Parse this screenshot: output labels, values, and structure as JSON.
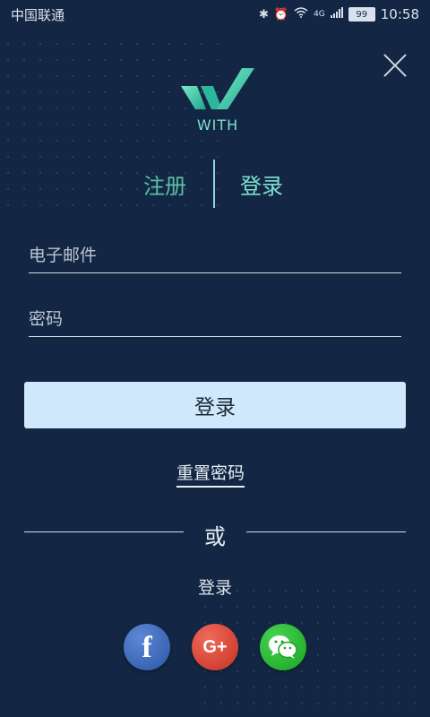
{
  "statusbar": {
    "carrier": "中国联通",
    "network": "4G",
    "battery": "99",
    "time": "10:58"
  },
  "brand": {
    "logo_text": "WITH"
  },
  "tabs": {
    "register": "注册",
    "login": "登录",
    "active": "login"
  },
  "form": {
    "email_placeholder": "电子邮件",
    "password_placeholder": "密码",
    "login_button": "登录"
  },
  "links": {
    "reset_password": "重置密码"
  },
  "divider": {
    "or": "或"
  },
  "social": {
    "label": "登录",
    "providers": [
      {
        "name": "facebook-icon",
        "color": "#3b5998"
      },
      {
        "name": "google-plus-icon",
        "color": "#dd4b39"
      },
      {
        "name": "wechat-icon",
        "color": "#1aad19"
      }
    ]
  },
  "colors": {
    "background": "#132744",
    "accent": "#7fe0cf",
    "button": "#cfe8fb"
  }
}
